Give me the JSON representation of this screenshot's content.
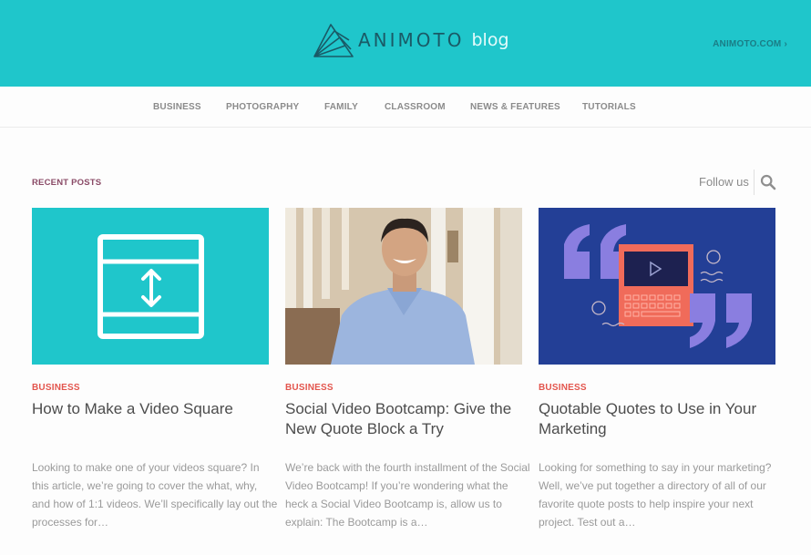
{
  "header": {
    "logo_word": "ANIMOTO",
    "logo_suffix": "blog",
    "external_link": "ANIMOTO.COM",
    "external_chevron": "›",
    "colors": {
      "brand_teal": "#1fc6cb",
      "logo_dark": "#1a5a66"
    }
  },
  "nav": {
    "items": [
      {
        "label": "BUSINESS"
      },
      {
        "label": "PHOTOGRAPHY"
      },
      {
        "label": "FAMILY"
      },
      {
        "label": "CLASSROOM"
      },
      {
        "label": "NEWS & FEATURES"
      },
      {
        "label": "TUTORIALS"
      }
    ]
  },
  "main": {
    "section_title": "RECENT POSTS",
    "follow_label": "Follow us",
    "search_icon": "search-icon",
    "posts": [
      {
        "category": "BUSINESS",
        "title": "How to Make a Video Square",
        "excerpt": "Looking to make one of your videos square? In this article, we’re going to cover the what, why, and how of 1:1 videos. We’ll specifically lay out the processes for…",
        "image": "square-video-illustration"
      },
      {
        "category": "BUSINESS",
        "title": "Social Video Bootcamp: Give the New Quote Block a Try",
        "excerpt": "We’re back with the fourth installment of the Social Video Bootcamp! If you’re wondering what the heck a Social Video Bootcamp is, allow us to explain: The Bootcamp is a…",
        "image": "smiling-man-photo"
      },
      {
        "category": "BUSINESS",
        "title": "Quotable Quotes to Use in Your Marketing",
        "excerpt": "Looking for something to say in your marketing? Well, we’ve put together a directory of all of our favorite quote posts to help inspire your next project. Test out a…",
        "image": "quote-marks-device-illustration"
      }
    ],
    "colors": {
      "category": "#e3554d",
      "section_title": "#8a4a66",
      "quote_bg": "#233f96",
      "quote_marks": "#8a7ee0",
      "device": "#f06b5a"
    }
  }
}
